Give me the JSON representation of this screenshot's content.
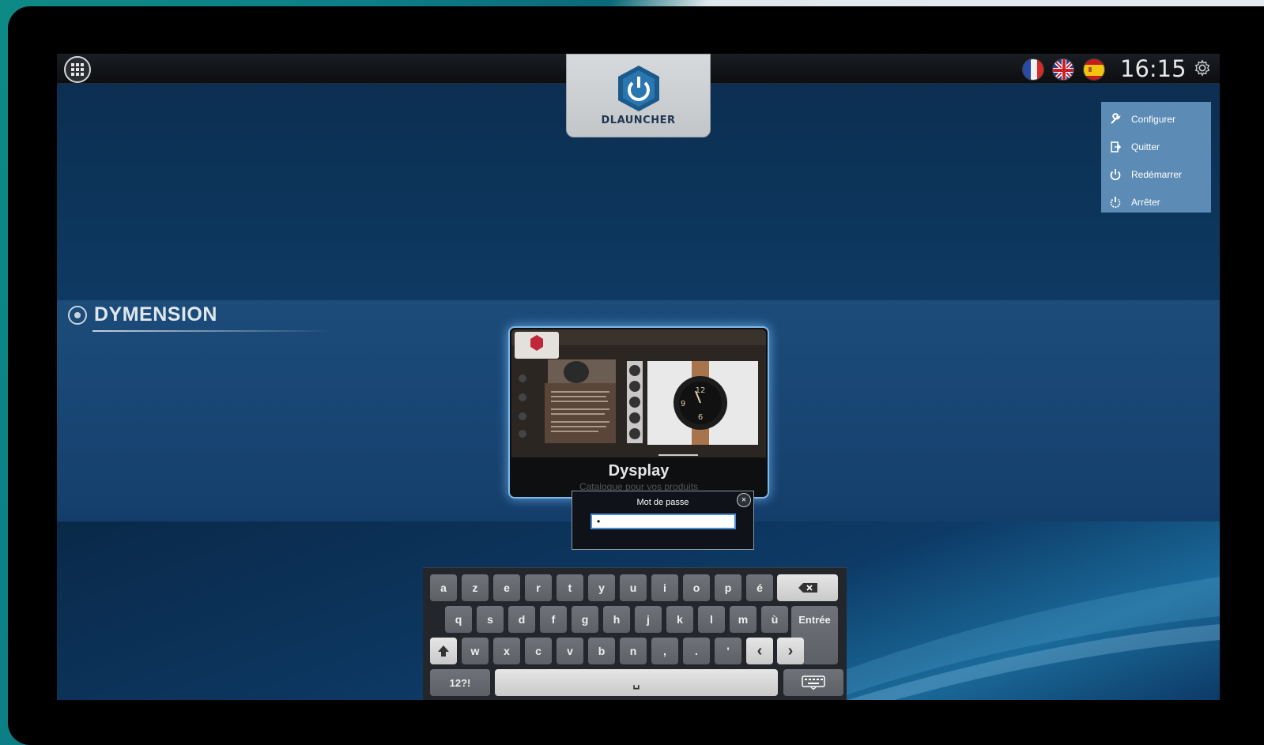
{
  "topbar": {
    "logo_text": "DLAUNCHER",
    "clock": "16:15",
    "flags": [
      "france-flag",
      "uk-flag",
      "spain-flag"
    ]
  },
  "settings_menu": {
    "items": [
      {
        "label": "Configurer",
        "icon": "wrench-icon"
      },
      {
        "label": "Quitter",
        "icon": "exit-icon"
      },
      {
        "label": "Redémarrer",
        "icon": "restart-icon"
      },
      {
        "label": "Arrêter",
        "icon": "power-icon"
      }
    ]
  },
  "section": {
    "title": "DYMENSION"
  },
  "app_card": {
    "title": "Dysplay",
    "subtitle": "Catalogue pour vos produits"
  },
  "password_dialog": {
    "title": "Mot de passe",
    "value": "•",
    "close": "×"
  },
  "keyboard": {
    "row1": [
      "a",
      "z",
      "e",
      "r",
      "t",
      "y",
      "u",
      "i",
      "o",
      "p",
      "é"
    ],
    "row2": [
      "q",
      "s",
      "d",
      "f",
      "g",
      "h",
      "j",
      "k",
      "l",
      "m",
      "ù"
    ],
    "enter": "Entrée",
    "row3": [
      "w",
      "x",
      "c",
      "v",
      "b",
      "n",
      ",",
      ".",
      "'"
    ],
    "left": "‹",
    "right": "›",
    "symbols": "12?!",
    "space": "␣"
  },
  "colors": {
    "menu_bg": "#5c8bb5",
    "screen_bg": "#0e3a63",
    "accent_border": "#7fb8e6"
  }
}
